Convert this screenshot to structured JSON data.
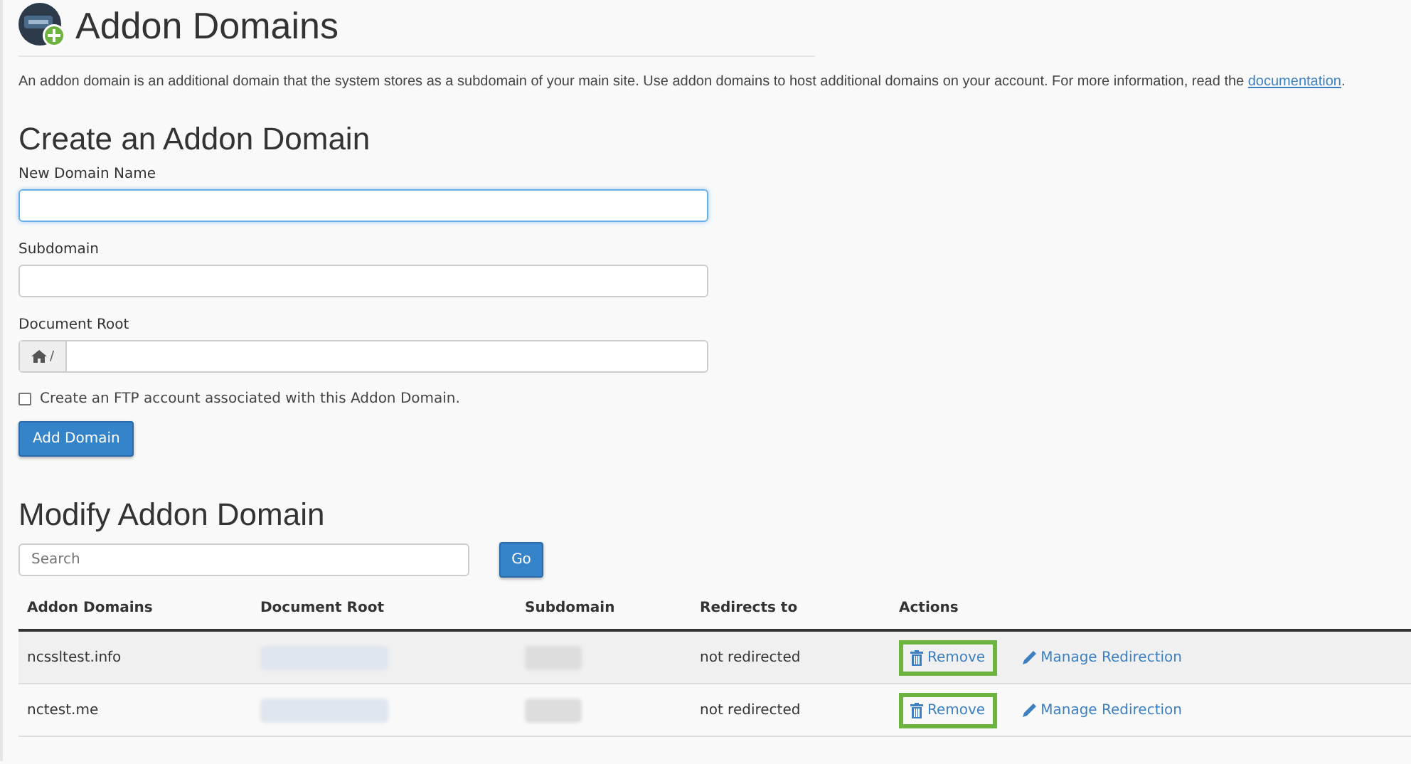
{
  "page": {
    "title": "Addon Domains",
    "description": "An addon domain is an additional domain that the system stores as a subdomain of your main site. Use addon domains to host additional domains on your account. For more information, read the ",
    "description_link": "documentation",
    "description_end": "."
  },
  "create": {
    "heading": "Create an Addon Domain",
    "fields": [
      {
        "label": "New Domain Name",
        "kind": "text",
        "focused": true
      },
      {
        "label": "Subdomain",
        "kind": "text",
        "focused": false
      },
      {
        "label": "Document Root",
        "kind": "path",
        "prefix": "/",
        "focused": false
      }
    ],
    "ftp_checkbox": {
      "label": "Create an FTP account associated with this Addon Domain.",
      "checked": false
    },
    "submit": "Add Domain"
  },
  "modify": {
    "heading": "Modify Addon Domain",
    "search": {
      "placeholder": "Search"
    },
    "go": "Go",
    "table": {
      "columns": [
        "Addon Domains",
        "Document Root",
        "Subdomain",
        "Redirects to",
        "Actions"
      ],
      "rows": [
        {
          "domain": "ncssltest.info",
          "redirects": "not redirected",
          "remove": "Remove",
          "remove_highlighted": true,
          "manage": "Manage Redirection"
        },
        {
          "domain": "nctest.me",
          "redirects": "not redirected",
          "remove": "Remove",
          "remove_highlighted": true,
          "manage": "Manage Redirection"
        }
      ]
    }
  }
}
